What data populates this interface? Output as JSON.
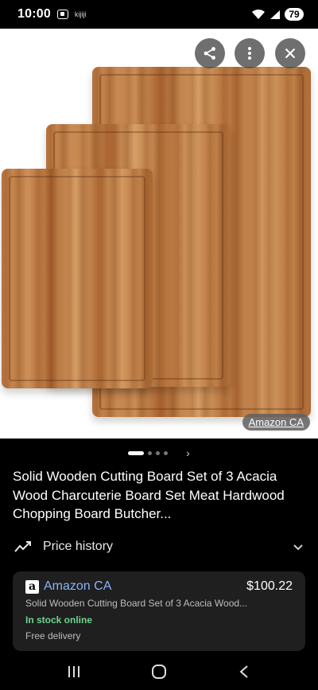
{
  "status_bar": {
    "time": "10:00",
    "app_label": "kijiji",
    "battery": "79"
  },
  "image_viewer": {
    "source_chip": "Amazon CA",
    "icons": {
      "share": "share-icon",
      "more": "more-vert-icon",
      "close": "close-icon"
    },
    "carousel": {
      "active_index": 0,
      "dot_count": 4
    }
  },
  "product": {
    "title": "Solid Wooden Cutting Board Set of 3 Acacia Wood Charcuterie Board Set Meat Hardwood Chopping Board Butcher..."
  },
  "price_history": {
    "label": "Price history"
  },
  "offer": {
    "store_logo": "a",
    "store_name": "Amazon CA",
    "price": "$100.22",
    "description": "Solid Wooden Cutting Board Set of 3 Acacia Wood...",
    "stock": "In stock online",
    "delivery": "Free delivery"
  },
  "colors": {
    "link": "#8ab4f8",
    "in_stock": "#6dd58c",
    "card_bg": "#1f1f1f"
  }
}
